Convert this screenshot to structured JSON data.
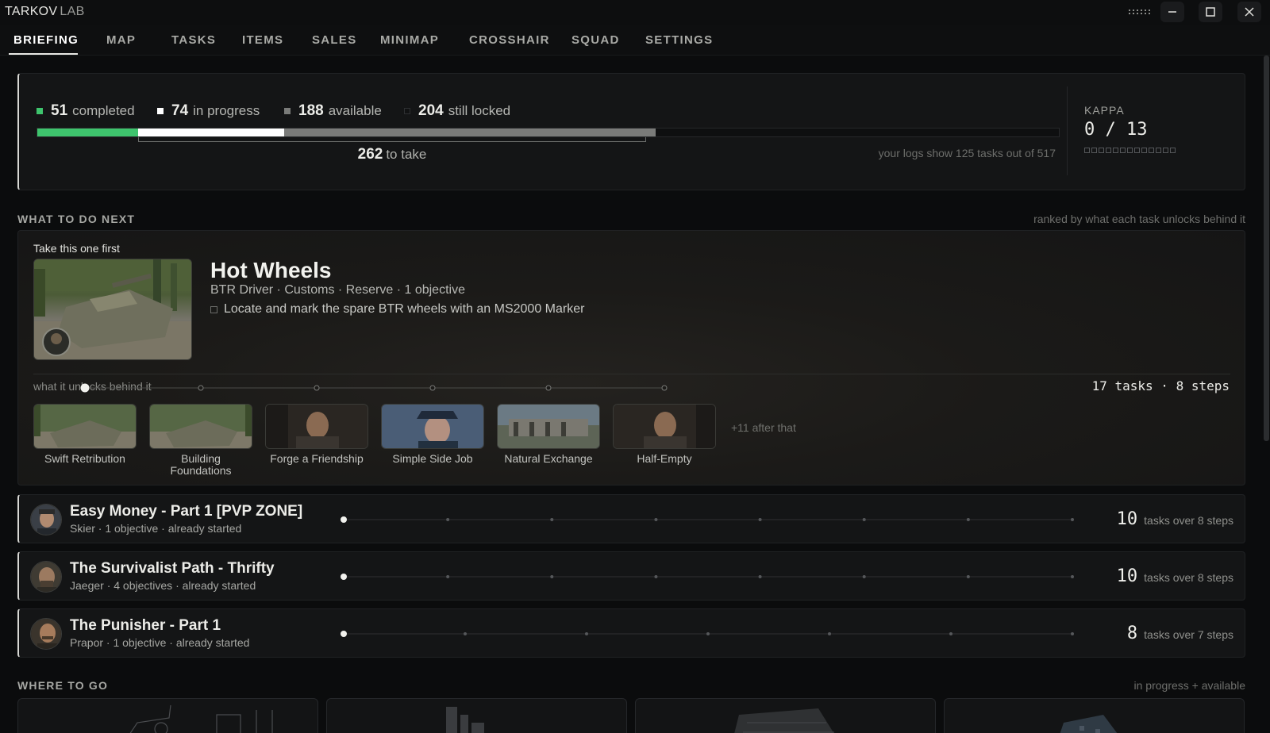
{
  "app": {
    "title": "TARKOV",
    "subtitle": "LAB"
  },
  "window_controls": {
    "grip": "grip-icon",
    "minimize": "minimize-icon",
    "maximize": "maximize-icon",
    "close": "close-icon"
  },
  "tabs": [
    {
      "label": "BRIEFING",
      "active": true
    },
    {
      "label": "MAP"
    },
    {
      "label": "TASKS"
    },
    {
      "label": "ITEMS"
    },
    {
      "label": "SALES"
    },
    {
      "label": "MINIMAP"
    },
    {
      "label": "CROSSHAIR"
    },
    {
      "label": "SQUAD"
    },
    {
      "label": "SETTINGS"
    }
  ],
  "colors": {
    "completed": "#3ec46d",
    "in_progress": "#ffffff",
    "available": "#7a7b79",
    "locked": "#101112",
    "background": "#0b0c0d",
    "panel": "#141516"
  },
  "progress": {
    "total": 517,
    "stats": [
      {
        "key": "completed",
        "value": "51",
        "label": "completed"
      },
      {
        "key": "in_progress",
        "value": "74",
        "label": "in progress"
      },
      {
        "key": "available",
        "value": "188",
        "label": "available"
      },
      {
        "key": "locked",
        "value": "204",
        "label": "still locked"
      }
    ],
    "to_take": {
      "value": "262",
      "label": "to take"
    },
    "logs_note": "your logs show 125 tasks out of 517"
  },
  "kappa": {
    "label": "KAPPA",
    "value": "0 / 13",
    "done": 0,
    "total": 13
  },
  "next": {
    "title": "WHAT TO DO NEXT",
    "note": "ranked by what each task unlocks behind it",
    "featured": {
      "kicker": "Take this one first",
      "title": "Hot Wheels",
      "meta": "BTR Driver · Customs · Reserve · 1 objective",
      "objective": "Locate and mark the spare BTR wheels with an MS2000 Marker",
      "unlocks_label": "what it unlocks behind it",
      "unlocks_count": "17 tasks · 8 steps",
      "unlocks": [
        {
          "name": "Swift Retribution",
          "image": "btr-thumbnail"
        },
        {
          "name": "Building Foundations",
          "image": "btr-thumbnail"
        },
        {
          "name": "Forge a Friendship",
          "image": "trader-portrait"
        },
        {
          "name": "Simple Side Job",
          "image": "officer-portrait"
        },
        {
          "name": "Natural Exchange",
          "image": "ruins-thumbnail"
        },
        {
          "name": "Half-Empty",
          "image": "trader-portrait"
        }
      ],
      "more": "+11 after that"
    },
    "tasks": [
      {
        "title": "Easy Money - Part 1 [PVP ZONE]",
        "meta": "Skier · 1 objective · already started",
        "count": "10",
        "count_label": "tasks over 8 steps",
        "steps": 8,
        "avatar": "skier-avatar"
      },
      {
        "title": "The Survivalist Path - Thrifty",
        "meta": "Jaeger · 4 objectives · already started",
        "count": "10",
        "count_label": "tasks over 8 steps",
        "steps": 8,
        "avatar": "jaeger-avatar"
      },
      {
        "title": "The Punisher - Part 1",
        "meta": "Prapor · 1 objective · already started",
        "count": "8",
        "count_label": "tasks over 7 steps",
        "steps": 7,
        "avatar": "prapor-avatar"
      }
    ]
  },
  "where": {
    "title": "WHERE TO GO",
    "note": "in progress + available"
  }
}
